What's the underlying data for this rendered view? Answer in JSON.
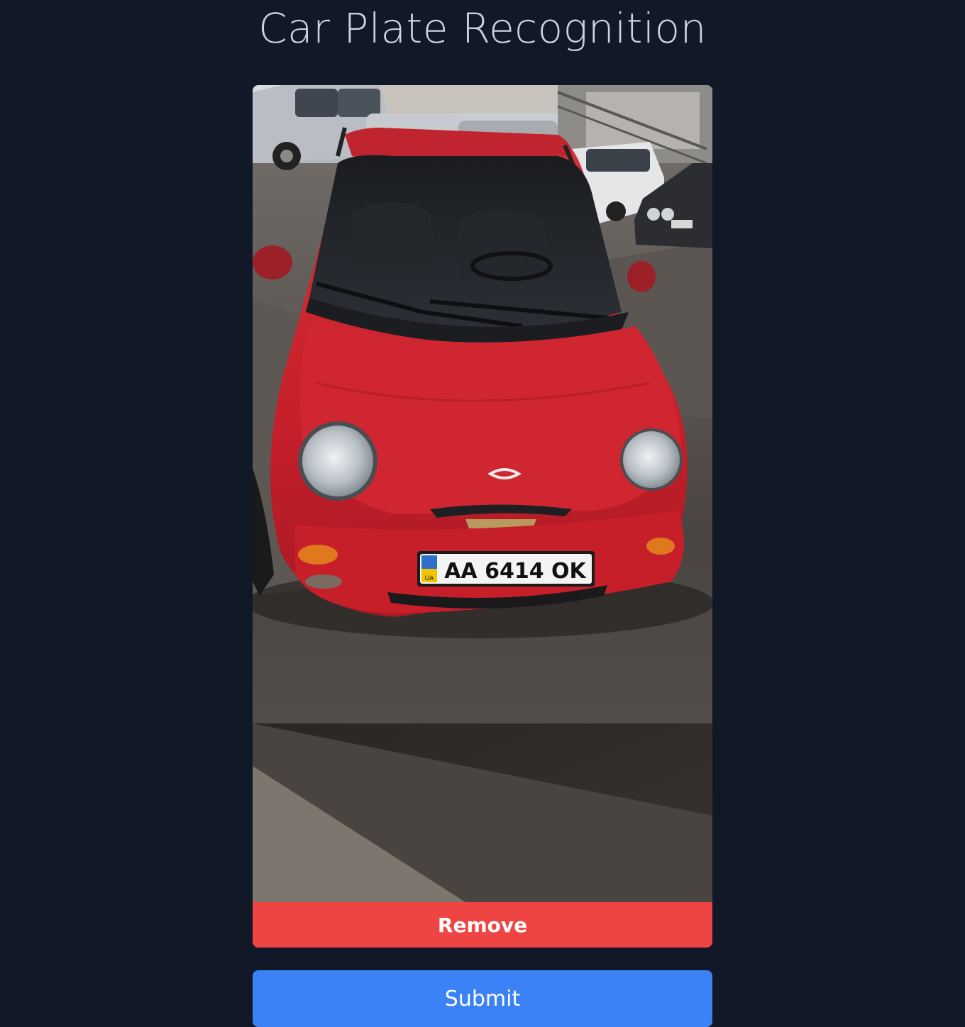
{
  "app": {
    "title": "Car Plate Recognition"
  },
  "preview": {
    "image_description_icon": "car-photo",
    "plate_text": "AA 6414 OK",
    "plate_country": "UA",
    "remove_label": "Remove"
  },
  "actions": {
    "submit_label": "Submit"
  },
  "colors": {
    "background": "#111827",
    "title": "#cbd5e1",
    "remove": "#ef4444",
    "submit": "#3b82f6"
  }
}
